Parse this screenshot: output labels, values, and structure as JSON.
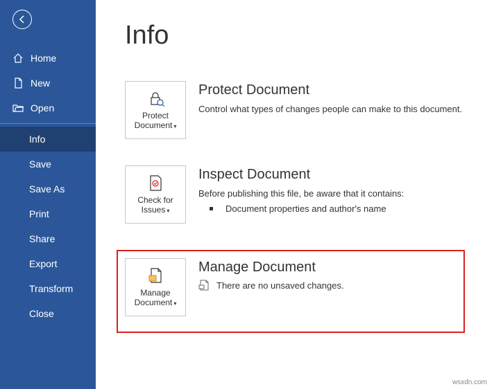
{
  "sidebar": {
    "primary": [
      {
        "label": "Home",
        "icon": "home"
      },
      {
        "label": "New",
        "icon": "file"
      },
      {
        "label": "Open",
        "icon": "folder"
      }
    ],
    "secondary": [
      {
        "label": "Info",
        "active": true
      },
      {
        "label": "Save"
      },
      {
        "label": "Save As"
      },
      {
        "label": "Print"
      },
      {
        "label": "Share"
      },
      {
        "label": "Export"
      },
      {
        "label": "Transform"
      },
      {
        "label": "Close"
      }
    ]
  },
  "page": {
    "title": "Info"
  },
  "protect": {
    "tile_label": "Protect Document",
    "title": "Protect Document",
    "desc": "Control what types of changes people can make to this document."
  },
  "inspect": {
    "tile_label": "Check for Issues",
    "title": "Inspect Document",
    "desc": "Before publishing this file, be aware that it contains:",
    "item1": "Document properties and author's name"
  },
  "manage": {
    "tile_label": "Manage Document",
    "title": "Manage Document",
    "status": "There are no unsaved changes."
  },
  "watermark": "wsxdn.com"
}
